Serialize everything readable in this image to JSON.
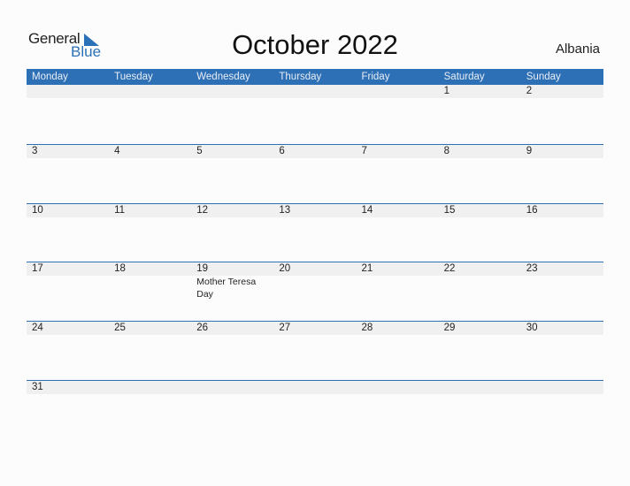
{
  "logo": {
    "general": "General",
    "blue": "Blue"
  },
  "title": "October 2022",
  "country": "Albania",
  "weekdays": [
    "Monday",
    "Tuesday",
    "Wednesday",
    "Thursday",
    "Friday",
    "Saturday",
    "Sunday"
  ],
  "weeks": [
    {
      "days": [
        "",
        "",
        "",
        "",
        "",
        "1",
        "2"
      ],
      "events": [
        "",
        "",
        "",
        "",
        "",
        "",
        ""
      ]
    },
    {
      "days": [
        "3",
        "4",
        "5",
        "6",
        "7",
        "8",
        "9"
      ],
      "events": [
        "",
        "",
        "",
        "",
        "",
        "",
        ""
      ]
    },
    {
      "days": [
        "10",
        "11",
        "12",
        "13",
        "14",
        "15",
        "16"
      ],
      "events": [
        "",
        "",
        "",
        "",
        "",
        "",
        ""
      ]
    },
    {
      "days": [
        "17",
        "18",
        "19",
        "20",
        "21",
        "22",
        "23"
      ],
      "events": [
        "",
        "",
        "Mother Teresa Day",
        "",
        "",
        "",
        ""
      ]
    },
    {
      "days": [
        "24",
        "25",
        "26",
        "27",
        "28",
        "29",
        "30"
      ],
      "events": [
        "",
        "",
        "",
        "",
        "",
        "",
        ""
      ]
    },
    {
      "days": [
        "31",
        "",
        "",
        "",
        "",
        "",
        ""
      ],
      "events": [
        "",
        "",
        "",
        "",
        "",
        "",
        ""
      ]
    }
  ],
  "colors": {
    "accent": "#2e70b5",
    "row_bg": "#f0f0f0"
  }
}
